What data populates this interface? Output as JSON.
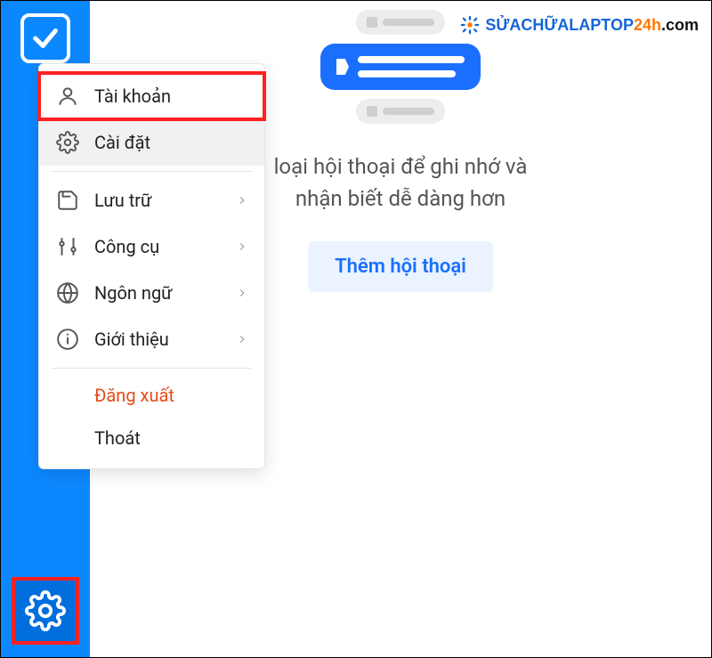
{
  "menu": {
    "account": "Tài khoản",
    "settings": "Cài đặt",
    "storage": "Lưu trữ",
    "tools": "Công cụ",
    "language": "Ngôn ngữ",
    "about": "Giới thiệu",
    "logout": "Đăng xuất",
    "exit": "Thoát"
  },
  "main": {
    "text_line1": "loại hội thoại để ghi nhớ và",
    "text_line2": "nhận biết dễ dàng hơn",
    "add_button": "Thêm hội thoại"
  },
  "watermark": {
    "part1": "SỬACHỮALAPTOP",
    "part2": "24h",
    "part3": ".com"
  }
}
